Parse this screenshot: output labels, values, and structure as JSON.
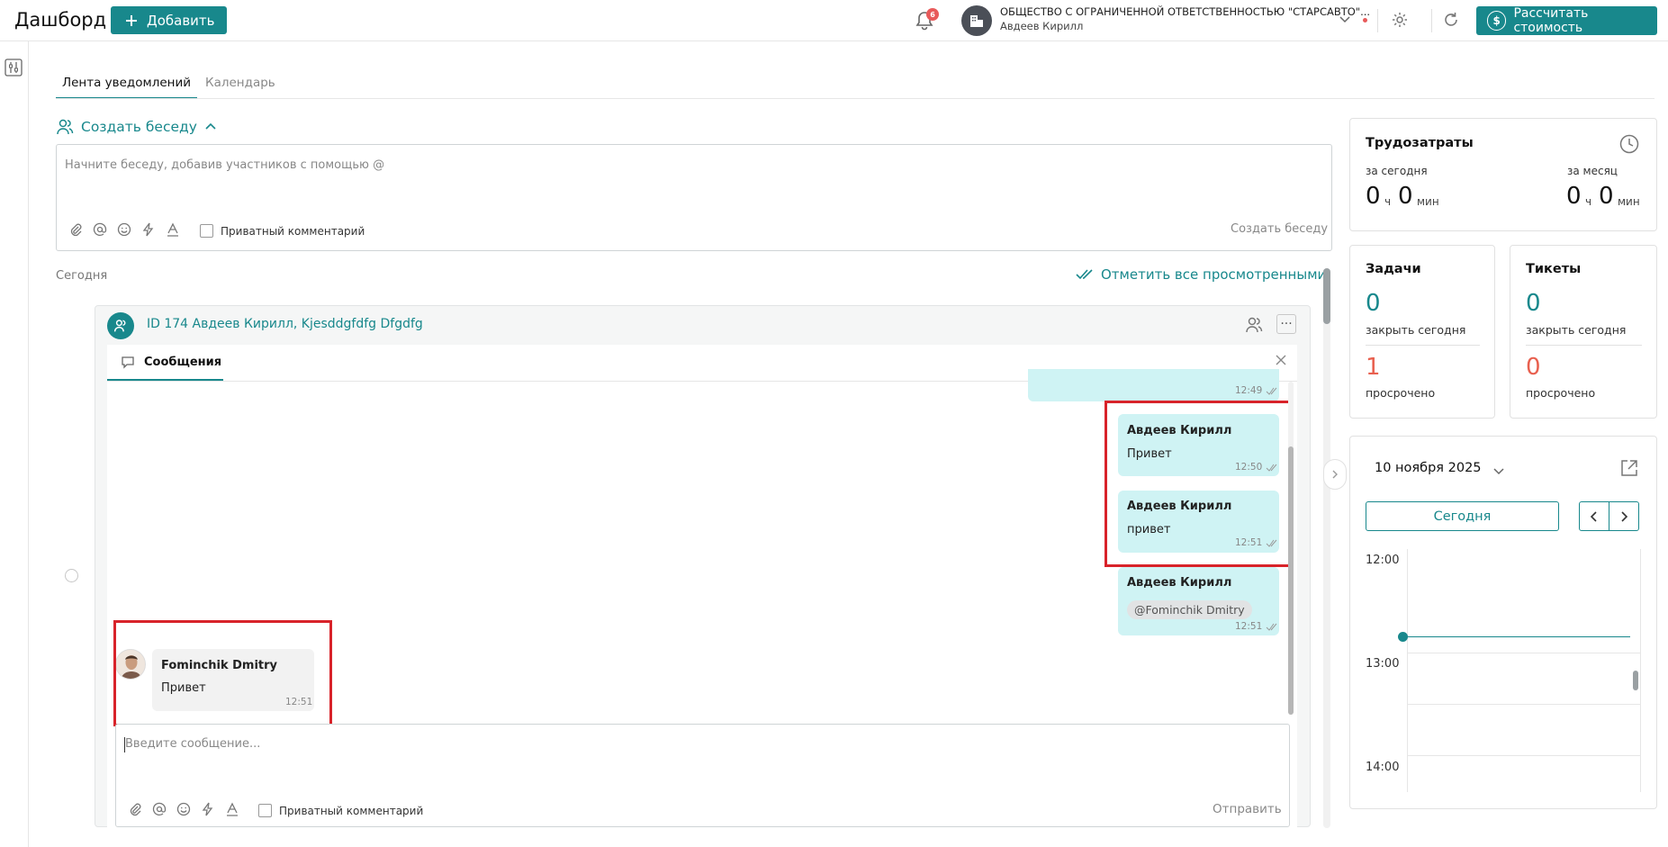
{
  "header": {
    "title": "Дашборд",
    "add_label": "Добавить",
    "notifications_count": "6",
    "company_name": "ОБЩЕСТВО С ОГРАНИЧЕННОЙ ОТВЕТСТВЕННОСТЬЮ \"СТАРСАВТО\"...",
    "user_name": "Авдеев Кирилл",
    "calc_label": "Рассчитать стоимость",
    "calc_icon": "$"
  },
  "tabs": [
    "Лента уведомлений",
    "Календарь"
  ],
  "create_conversation": {
    "label": "Создать беседу",
    "placeholder": "Начните беседу, добавив участников с помощью @",
    "private_label": "Приватный комментарий",
    "submit_label": "Создать беседу"
  },
  "feed": {
    "today_label": "Сегодня",
    "mark_all_label": "Отметить все просмотренными"
  },
  "conversation": {
    "title": "ID 174 Авдеев Кирилл, Kjesddgfdfg Dfgdfg",
    "messages_tab": "Сообщения",
    "messages": [
      {
        "time": "12:49"
      },
      {
        "sender": "Авдеев Кирилл",
        "text": "Привет",
        "time": "12:50"
      },
      {
        "sender": "Авдеев Кирилл",
        "text": "привет",
        "time": "12:51"
      },
      {
        "sender": "Авдеев Кирилл",
        "mention": "@Fominchik Dmitry",
        "time": "12:51"
      },
      {
        "sender": "Fominchik Dmitry",
        "text": "Привет",
        "time": "12:51"
      }
    ],
    "compose_placeholder": "Введите сообщение...",
    "private_label": "Приватный комментарий",
    "send_label": "Отправить"
  },
  "labor": {
    "title": "Трудозатраты",
    "today_label": "за сегодня",
    "month_label": "за месяц",
    "today_hours": "0",
    "today_minutes": "0",
    "month_hours": "0",
    "month_minutes": "0",
    "hours_unit": "ч",
    "minutes_unit": "мин"
  },
  "tasks": {
    "title": "Задачи",
    "close_today": "0",
    "close_today_label": "закрыть сегодня",
    "overdue": "1",
    "overdue_label": "просрочено"
  },
  "tickets": {
    "title": "Тикеты",
    "close_today": "0",
    "close_today_label": "закрыть сегодня",
    "overdue": "0",
    "overdue_label": "просрочено"
  },
  "calendar": {
    "date": "10 ноября 2025",
    "today_label": "Сегодня",
    "hours": [
      "12:00",
      "13:00",
      "14:00"
    ]
  },
  "colors": {
    "accent": "#18888c",
    "own_bubble": "#cff3f4",
    "other_bubble": "#f2f2f2",
    "highlight": "#d8232a",
    "overdue": "#e8604f"
  }
}
